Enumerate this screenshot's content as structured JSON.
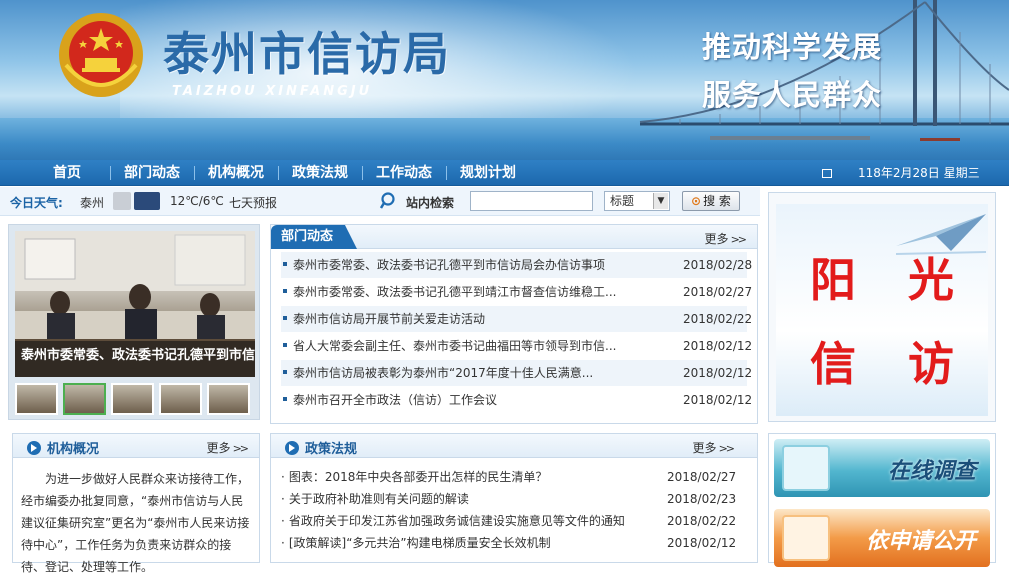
{
  "header": {
    "title": "泰州市信访局",
    "pinyin": "TAIZHOU XINFANGJU",
    "slogan_line1": "推动科学发展",
    "slogan_line2": "服务人民群众"
  },
  "nav": {
    "items": [
      {
        "label": "首页"
      },
      {
        "label": "部门动态"
      },
      {
        "label": "机构概况"
      },
      {
        "label": "政策法规"
      },
      {
        "label": "工作动态"
      },
      {
        "label": "规划计划"
      }
    ],
    "date": "118年2月28日 星期三"
  },
  "weather": {
    "label": "今日天气:",
    "city": "泰州",
    "temperature": "12℃/6℃",
    "forecast_link": "七天预报"
  },
  "search": {
    "label": "站内检索",
    "input_value": "",
    "scope_selected": "标题",
    "button_label": "搜 索"
  },
  "slideshow": {
    "caption": "泰州市委常委、政法委书记孔德平到市信访局会办信访事项"
  },
  "news": {
    "title": "部门动态",
    "more": "更多",
    "items": [
      {
        "title": "泰州市委常委、政法委书记孔德平到市信访局会办信访事项",
        "date": "2018/02/28"
      },
      {
        "title": "泰州市委常委、政法委书记孔德平到靖江市督查信访维稳工...",
        "date": "2018/02/27"
      },
      {
        "title": "泰州市信访局开展节前关爱走访活动",
        "date": "2018/02/22"
      },
      {
        "title": "省人大常委会副主任、泰州市委书记曲福田等市领导到市信...",
        "date": "2018/02/12"
      },
      {
        "title": "泰州市信访局被表彰为泰州市“2017年度十佳人民满意...",
        "date": "2018/02/12"
      },
      {
        "title": "泰州市召开全市政法（信访）工作会议",
        "date": "2018/02/12"
      }
    ]
  },
  "org": {
    "title": "机构概况",
    "more": "更多",
    "text": "为进一步做好人民群众来访接待工作，经市编委办批复同意，“泰州市信访与人民建议征集研究室”更名为“泰州市人民来访接待中心”，工作任务为负责来访群众的接待、登记、处理等工作。"
  },
  "policy": {
    "title": "政策法规",
    "more": "更多",
    "items": [
      {
        "title": "图表：2018年中央各部委开出怎样的民生清单？",
        "date": "2018/02/27"
      },
      {
        "title": "关于政府补助准则有关问题的解读",
        "date": "2018/02/23"
      },
      {
        "title": "省政府关于印发江苏省加强政务诚信建设实施意见等文件的通知",
        "date": "2018/02/22"
      },
      {
        "title": "[政策解读]“多元共治”构建电梯质量安全长效机制",
        "date": "2018/02/12"
      }
    ]
  },
  "sidebar": {
    "sunshine": [
      "阳",
      "光",
      "信",
      "访"
    ],
    "survey": "在线调查",
    "apply": "依申请公开"
  },
  "colors": {
    "nav_bg": "#1f6db3",
    "accent_red": "#e21b1b",
    "title_blue": "#2a6aa8"
  }
}
